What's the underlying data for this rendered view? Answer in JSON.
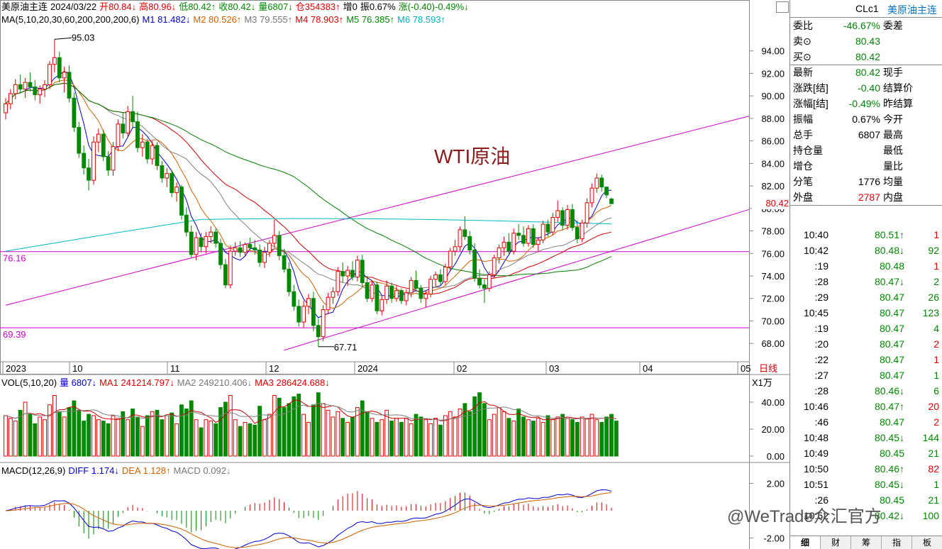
{
  "header": {
    "line1": [
      {
        "text": "美原油主连",
        "color": "k"
      },
      {
        "text": "2024/03/22",
        "color": "k"
      },
      {
        "text": "开80.84↓",
        "color": "r"
      },
      {
        "text": "高80.96↓",
        "color": "r"
      },
      {
        "text": "低80.42↑",
        "color": "g"
      },
      {
        "text": "收80.42↓",
        "color": "g"
      },
      {
        "text": "量6807↓",
        "color": "g"
      },
      {
        "text": "仓354383↑",
        "color": "r"
      },
      {
        "text": "增0",
        "color": "k"
      },
      {
        "text": "振0.67%",
        "color": "k"
      },
      {
        "text": "涨(-0.40)-0.49%↓",
        "color": "g"
      }
    ],
    "line2": [
      {
        "text": "MA(5,10,20,30,60,200,200,200,6)",
        "color": "k"
      },
      {
        "text": "M1 81.482↓",
        "color": "b"
      },
      {
        "text": "M2 80.526↑",
        "color": "o"
      },
      {
        "text": "M3 79.555↑",
        "color": "gr"
      },
      {
        "text": "M4 78.903↑",
        "color": "r"
      },
      {
        "text": "M5 76.385↑",
        "color": "g"
      },
      {
        "text": "M6 78.593↑",
        "color": "c"
      }
    ]
  },
  "chart_title": "WTI原油",
  "price_axis": {
    "ticks": [
      "94.00",
      "92.00",
      "90.00",
      "88.00",
      "86.00",
      "84.00",
      "82.00",
      "80.00",
      "78.00",
      "76.00",
      "74.00",
      "72.00",
      "70.00",
      "68.00"
    ],
    "current": "80.42"
  },
  "date_axis": {
    "labels": [
      "2023",
      "10",
      "11",
      "12",
      "2024",
      "02",
      "03",
      "04",
      "05"
    ],
    "period": "日线"
  },
  "annotations": {
    "high": "95.03",
    "low": "67.71",
    "h_line_1": "76.16",
    "h_line_2": "69.39"
  },
  "volume_panel": {
    "legend": [
      {
        "text": "VOL(5,10,20)",
        "color": "k"
      },
      {
        "text": "量 6807↓",
        "color": "b"
      },
      {
        "text": "MA1 241214.797↓",
        "color": "r"
      },
      {
        "text": "MA2 249210.406↓",
        "color": "gr"
      },
      {
        "text": "MA3 286424.688↓",
        "color": "r"
      }
    ],
    "unit": "X1万",
    "ticks": [
      "40.00",
      "20.00",
      "0.00"
    ]
  },
  "macd_panel": {
    "legend": [
      {
        "text": "MACD(12,26,9)",
        "color": "k"
      },
      {
        "text": "DIFF 1.174↓",
        "color": "b"
      },
      {
        "text": "DEA 1.128↑",
        "color": "o"
      },
      {
        "text": "MACD 0.092↓",
        "color": "gr"
      }
    ],
    "ticks": [
      "2.00",
      "-2.00"
    ]
  },
  "colors": {
    "up": "#e00000",
    "down": "#008800",
    "ma1": "#0000cc",
    "ma2": "#d06000",
    "ma3": "#808080",
    "ma4": "#cc0000",
    "ma5": "#008000",
    "ma6": "#00b8c8",
    "channel": "#cc00cc",
    "hline": "#cc00cc",
    "axis": "#888888"
  },
  "side_panel": {
    "code": "CLc1",
    "name": "美原油主连",
    "quote_rows": [
      {
        "label": "委比",
        "value": "-46.67%",
        "vcolor": "g",
        "label2": "委差"
      },
      {
        "label": "卖⊙",
        "value": "80.43",
        "vcolor": "g",
        "label2": ""
      },
      {
        "label": "买⊙",
        "value": "80.42",
        "vcolor": "g",
        "label2": ""
      },
      {
        "label": "最新",
        "value": "80.42",
        "vcolor": "g",
        "label2": "现手"
      },
      {
        "label": "涨跌[结]",
        "value": "-0.40",
        "vcolor": "g",
        "label2": "结算价"
      },
      {
        "label": "涨幅[结]",
        "value": "-0.49%",
        "vcolor": "g",
        "label2": "昨结算"
      },
      {
        "label": "振幅",
        "value": "0.67%",
        "vcolor": "k",
        "label2": "今开"
      },
      {
        "label": "总手",
        "value": "6807",
        "vcolor": "k",
        "label2": "最高"
      },
      {
        "label": "持仓量",
        "value": "",
        "vcolor": "k",
        "label2": "最低"
      },
      {
        "label": "增仓",
        "value": "",
        "vcolor": "k",
        "label2": "量比"
      },
      {
        "label": "分笔",
        "value": "1776",
        "vcolor": "k",
        "label2": "均量"
      },
      {
        "label": "外盘",
        "value": "2787",
        "vcolor": "r",
        "label2": "内盘"
      }
    ],
    "ticks": [
      {
        "time": "10:40",
        "price": "80.51↑",
        "pcolor": "g",
        "vol": "1",
        "vcolor": "r"
      },
      {
        "time": "10:42",
        "price": "80.48↓",
        "pcolor": "g",
        "vol": "92",
        "vcolor": "g"
      },
      {
        "time": ":19",
        "price": "80.48",
        "pcolor": "g",
        "vol": "1",
        "vcolor": "r"
      },
      {
        "time": ":28",
        "price": "80.47↓",
        "pcolor": "g",
        "vol": "2",
        "vcolor": "g"
      },
      {
        "time": ":29",
        "price": "80.47",
        "pcolor": "g",
        "vol": "26",
        "vcolor": "g"
      },
      {
        "time": "10:45",
        "price": "80.47",
        "pcolor": "g",
        "vol": "123",
        "vcolor": "g"
      },
      {
        "time": ":19",
        "price": "80.47",
        "pcolor": "g",
        "vol": "4",
        "vcolor": "g"
      },
      {
        "time": ":20",
        "price": "80.47",
        "pcolor": "g",
        "vol": "2",
        "vcolor": "r"
      },
      {
        "time": ":22",
        "price": "80.47",
        "pcolor": "g",
        "vol": "1",
        "vcolor": "r"
      },
      {
        "time": ":27",
        "price": "80.47",
        "pcolor": "g",
        "vol": "1",
        "vcolor": "g"
      },
      {
        "time": ":28",
        "price": "80.46↓",
        "pcolor": "g",
        "vol": "6",
        "vcolor": "g"
      },
      {
        "time": "10:46",
        "price": "80.47↑",
        "pcolor": "g",
        "vol": "20",
        "vcolor": "r"
      },
      {
        "time": ":46",
        "price": "80.47",
        "pcolor": "g",
        "vol": "2",
        "vcolor": "r"
      },
      {
        "time": "10:48",
        "price": "80.45↓",
        "pcolor": "g",
        "vol": "144",
        "vcolor": "g"
      },
      {
        "time": "10:49",
        "price": "80.45",
        "pcolor": "g",
        "vol": "21",
        "vcolor": "g"
      },
      {
        "time": "10:50",
        "price": "80.46↑",
        "pcolor": "g",
        "vol": "82",
        "vcolor": "r"
      },
      {
        "time": "10:51",
        "price": "80.45↓",
        "pcolor": "g",
        "vol": "1",
        "vcolor": "g"
      },
      {
        "time": ":26",
        "price": "80.45",
        "pcolor": "g",
        "vol": "21",
        "vcolor": "g"
      },
      {
        "time": "10:52",
        "price": "80.42↓",
        "pcolor": "g",
        "vol": "100",
        "vcolor": "g"
      }
    ],
    "tabs": [
      "细",
      "财",
      "筹",
      "指",
      "板"
    ]
  },
  "watermark": "@WeTrade众汇官方",
  "chart_data": {
    "type": "candlestick",
    "title": "WTI原油",
    "ylim": [
      66.5,
      96
    ],
    "series_ohlc": [
      [
        88.5,
        89.8,
        87.9,
        89.3
      ],
      [
        89.3,
        90.6,
        88.8,
        90.2
      ],
      [
        90.2,
        91.5,
        89.7,
        91.0
      ],
      [
        91.0,
        91.9,
        90.2,
        90.6
      ],
      [
        90.6,
        91.6,
        89.8,
        91.2
      ],
      [
        91.2,
        92.1,
        90.4,
        90.8
      ],
      [
        90.8,
        91.4,
        89.6,
        90.1
      ],
      [
        90.1,
        90.9,
        89.3,
        90.6
      ],
      [
        90.6,
        91.4,
        89.9,
        91.0
      ],
      [
        91.0,
        93.1,
        90.6,
        92.8
      ],
      [
        92.8,
        95.03,
        92.1,
        93.4
      ],
      [
        93.4,
        93.9,
        91.2,
        91.6
      ],
      [
        91.6,
        92.6,
        90.3,
        92.1
      ],
      [
        92.1,
        92.7,
        89.4,
        89.8
      ],
      [
        89.8,
        90.3,
        86.8,
        87.2
      ],
      [
        87.2,
        87.7,
        84.5,
        84.9
      ],
      [
        84.9,
        85.6,
        83.0,
        83.6
      ],
      [
        83.6,
        84.4,
        81.6,
        82.5
      ],
      [
        82.5,
        86.4,
        82.1,
        85.9
      ],
      [
        85.9,
        87.1,
        85.0,
        86.6
      ],
      [
        86.6,
        87.0,
        84.2,
        84.6
      ],
      [
        84.6,
        85.1,
        82.9,
        83.4
      ],
      [
        83.4,
        85.9,
        82.9,
        85.5
      ],
      [
        85.5,
        87.9,
        85.1,
        87.5
      ],
      [
        87.5,
        88.5,
        86.2,
        86.7
      ],
      [
        86.7,
        89.1,
        86.3,
        88.6
      ],
      [
        88.6,
        90.0,
        87.2,
        87.7
      ],
      [
        87.7,
        88.6,
        85.0,
        85.4
      ],
      [
        85.4,
        86.6,
        84.6,
        85.9
      ],
      [
        85.9,
        86.2,
        84.0,
        84.4
      ],
      [
        84.4,
        86.0,
        83.9,
        85.6
      ],
      [
        85.6,
        85.9,
        83.4,
        83.8
      ],
      [
        83.8,
        84.2,
        82.3,
        82.7
      ],
      [
        82.7,
        83.6,
        81.9,
        83.1
      ],
      [
        83.1,
        83.4,
        81.0,
        81.4
      ],
      [
        81.4,
        82.3,
        80.6,
        81.9
      ],
      [
        81.9,
        82.1,
        79.0,
        79.4
      ],
      [
        79.4,
        80.1,
        77.5,
        77.9
      ],
      [
        77.9,
        78.5,
        75.6,
        75.9
      ],
      [
        75.9,
        77.9,
        75.4,
        77.4
      ],
      [
        77.4,
        77.8,
        76.1,
        76.6
      ],
      [
        76.6,
        77.9,
        76.0,
        77.5
      ],
      [
        77.5,
        78.4,
        76.9,
        77.9
      ],
      [
        77.9,
        78.2,
        76.5,
        76.9
      ],
      [
        76.9,
        77.3,
        74.6,
        75.0
      ],
      [
        75.0,
        75.5,
        72.9,
        73.2
      ],
      [
        73.2,
        76.7,
        72.9,
        76.2
      ],
      [
        76.2,
        77.0,
        75.8,
        76.5
      ],
      [
        76.5,
        77.1,
        75.7,
        76.1
      ],
      [
        76.1,
        77.0,
        75.8,
        76.8
      ],
      [
        76.8,
        77.4,
        76.3,
        76.5
      ],
      [
        76.5,
        77.2,
        75.9,
        76.3
      ],
      [
        76.3,
        76.8,
        74.8,
        75.2
      ],
      [
        75.2,
        76.6,
        74.7,
        76.1
      ],
      [
        76.1,
        77.2,
        75.7,
        76.9
      ],
      [
        76.9,
        79.0,
        76.5,
        77.6
      ],
      [
        77.6,
        78.0,
        75.4,
        75.8
      ],
      [
        75.8,
        76.4,
        74.3,
        74.6
      ],
      [
        74.6,
        75.2,
        72.2,
        72.6
      ],
      [
        72.6,
        73.2,
        70.9,
        71.3
      ],
      [
        71.3,
        71.9,
        69.5,
        69.9
      ],
      [
        69.9,
        71.8,
        69.4,
        71.3
      ],
      [
        71.3,
        72.4,
        70.6,
        72.0
      ],
      [
        72.0,
        72.6,
        69.1,
        69.6
      ],
      [
        69.6,
        70.2,
        67.71,
        68.6
      ],
      [
        68.6,
        71.4,
        68.2,
        71.0
      ],
      [
        71.0,
        72.5,
        70.6,
        72.1
      ],
      [
        72.1,
        73.0,
        71.5,
        72.6
      ],
      [
        72.6,
        74.8,
        72.2,
        74.4
      ],
      [
        74.4,
        75.2,
        73.4,
        74.0
      ],
      [
        74.0,
        74.9,
        73.1,
        74.5
      ],
      [
        74.5,
        75.3,
        73.6,
        73.9
      ],
      [
        73.9,
        75.8,
        73.5,
        75.4
      ],
      [
        75.4,
        75.9,
        73.0,
        73.4
      ],
      [
        73.4,
        74.0,
        71.7,
        72.0
      ],
      [
        72.0,
        73.6,
        71.7,
        73.2
      ],
      [
        73.2,
        73.5,
        70.6,
        70.9
      ],
      [
        70.9,
        72.2,
        70.5,
        71.9
      ],
      [
        71.9,
        73.6,
        71.5,
        73.1
      ],
      [
        73.1,
        73.4,
        71.6,
        72.0
      ],
      [
        72.0,
        73.1,
        71.7,
        72.7
      ],
      [
        72.7,
        72.9,
        71.5,
        71.8
      ],
      [
        71.8,
        72.8,
        71.4,
        72.5
      ],
      [
        72.5,
        73.9,
        72.1,
        73.6
      ],
      [
        73.6,
        74.5,
        72.6,
        72.9
      ],
      [
        72.9,
        73.2,
        71.6,
        72.0
      ],
      [
        72.0,
        72.7,
        71.2,
        72.4
      ],
      [
        72.4,
        74.0,
        72.1,
        73.7
      ],
      [
        73.7,
        74.4,
        73.0,
        74.1
      ],
      [
        74.1,
        74.6,
        73.2,
        73.5
      ],
      [
        73.5,
        75.1,
        73.2,
        74.8
      ],
      [
        74.8,
        76.5,
        74.5,
        76.2
      ],
      [
        76.2,
        77.2,
        75.8,
        76.6
      ],
      [
        76.6,
        78.4,
        76.2,
        78.1
      ],
      [
        78.1,
        79.3,
        77.2,
        77.5
      ],
      [
        77.5,
        78.0,
        75.9,
        76.3
      ],
      [
        76.3,
        76.9,
        73.5,
        73.8
      ],
      [
        73.8,
        74.6,
        72.9,
        73.2
      ],
      [
        73.2,
        73.7,
        71.6,
        72.9
      ],
      [
        72.9,
        74.4,
        72.6,
        74.1
      ],
      [
        74.1,
        75.9,
        73.8,
        75.6
      ],
      [
        75.6,
        76.8,
        75.1,
        76.5
      ],
      [
        76.5,
        77.5,
        75.8,
        77.0
      ],
      [
        77.0,
        77.8,
        75.8,
        76.2
      ],
      [
        76.2,
        78.2,
        75.9,
        77.8
      ],
      [
        77.8,
        78.6,
        77.2,
        77.6
      ],
      [
        77.6,
        78.4,
        76.6,
        76.9
      ],
      [
        76.9,
        78.5,
        76.6,
        78.2
      ],
      [
        78.2,
        78.6,
        76.5,
        76.8
      ],
      [
        76.8,
        77.5,
        76.1,
        77.2
      ],
      [
        77.2,
        78.9,
        76.9,
        78.6
      ],
      [
        78.6,
        79.0,
        77.5,
        77.9
      ],
      [
        77.9,
        79.6,
        77.6,
        79.2
      ],
      [
        79.2,
        80.7,
        78.8,
        79.8
      ],
      [
        79.8,
        80.1,
        78.1,
        78.5
      ],
      [
        78.5,
        80.3,
        78.1,
        79.9
      ],
      [
        79.9,
        80.4,
        78.0,
        78.3
      ],
      [
        78.3,
        78.9,
        76.9,
        77.3
      ],
      [
        77.3,
        79.0,
        77.0,
        78.7
      ],
      [
        78.7,
        80.9,
        78.3,
        80.5
      ],
      [
        80.5,
        82.2,
        80.1,
        81.8
      ],
      [
        81.8,
        83.1,
        81.4,
        82.7
      ],
      [
        82.7,
        83.0,
        81.5,
        81.9
      ],
      [
        81.9,
        81.9,
        80.9,
        81.2
      ],
      [
        80.84,
        80.96,
        80.42,
        80.42
      ]
    ],
    "volume": [
      30,
      28,
      26,
      34,
      40,
      31,
      24,
      29,
      27,
      38,
      45,
      33,
      29,
      36,
      41,
      34,
      26,
      31,
      30,
      27,
      26,
      24,
      30,
      28,
      33,
      27,
      35,
      29,
      22,
      30,
      33,
      34,
      27,
      30,
      32,
      24,
      38,
      35,
      41,
      27,
      21,
      27,
      26,
      24,
      36,
      40,
      45,
      27,
      22,
      25,
      24,
      23,
      37,
      27,
      31,
      45,
      43,
      36,
      39,
      44,
      46,
      31,
      25,
      38,
      47,
      39,
      34,
      29,
      33,
      28,
      25,
      29,
      36,
      41,
      33,
      28,
      25,
      27,
      34,
      26,
      28,
      25,
      28,
      24,
      31,
      29,
      27,
      24,
      28,
      23,
      30,
      33,
      29,
      35,
      39,
      33,
      44,
      47,
      39,
      27,
      31,
      36,
      33,
      28,
      26,
      35,
      29,
      27,
      26,
      28,
      25,
      30,
      27,
      29,
      31,
      28,
      27,
      25,
      29,
      28,
      31,
      27,
      25,
      29,
      31,
      26
    ],
    "moving_averages_labels": [
      "M1",
      "M2",
      "M3",
      "M4",
      "M5",
      "M6"
    ],
    "channel_lines": "two parallel rising trend lines",
    "horizontal_levels": [
      76.16,
      69.39
    ],
    "macd": {
      "diff": 1.174,
      "dea": 1.128,
      "macd": 0.092
    }
  }
}
